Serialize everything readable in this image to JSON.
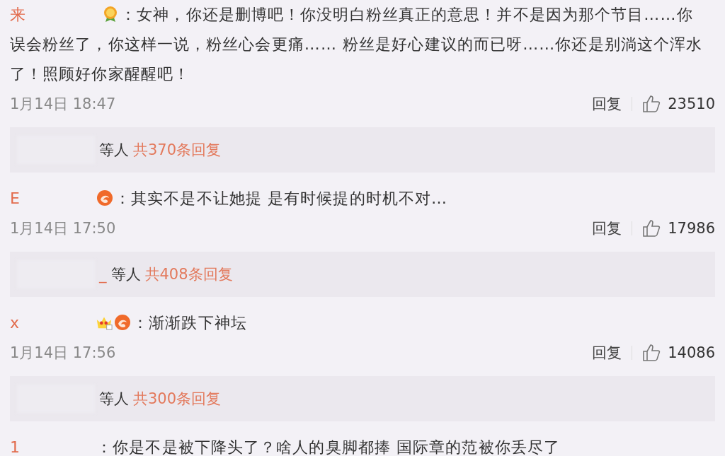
{
  "comments": [
    {
      "name_fragment": "来",
      "badges": [
        {
          "kind": "medal"
        }
      ],
      "text": "：女神，你还是删博吧！你没明白粉丝真正的意思！并不是因为那个节目……你误会粉丝了，你这样一说，粉丝心会更痛…… 粉丝是好心建议的而已呀……你还是别淌这个浑水了！照顾好你家醒醒吧！",
      "time": "1月14日 18:47",
      "reply_label": "回复",
      "likes": "23510",
      "replies": {
        "suffix": "等人",
        "count": "共370条回复"
      }
    },
    {
      "name_fragment": "E",
      "badges": [
        {
          "kind": "swirl"
        }
      ],
      "text": "：其实不是不让她提 是有时候提的时机不对…",
      "time": "1月14日 17:50",
      "reply_label": "回复",
      "likes": "17986",
      "replies": {
        "name_tail": "_",
        "suffix": "等人",
        "count": "共408条回复"
      }
    },
    {
      "name_fragment": "x",
      "badges": [
        {
          "kind": "crown"
        },
        {
          "kind": "swirl"
        }
      ],
      "text": "：渐渐跌下神坛",
      "time": "1月14日 17:56",
      "reply_label": "回复",
      "likes": "14086",
      "replies": {
        "suffix": "等人",
        "count": "共300条回复"
      }
    },
    {
      "name_fragment": "1",
      "text": "：你是不是被下降头了？啥人的臭脚都捧 国际章的范被你丢尽了"
    }
  ]
}
